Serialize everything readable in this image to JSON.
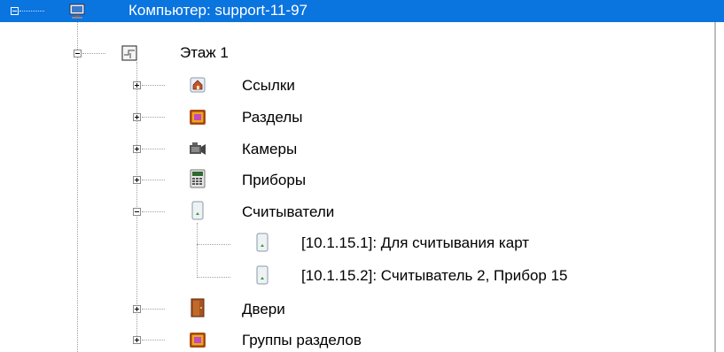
{
  "tree": {
    "root": {
      "label": "Компьютер: support-11-97",
      "icon": "computer-icon",
      "expanded": true,
      "selected": true
    },
    "floor": {
      "label": "Этаж 1",
      "icon": "floor-plan-icon",
      "expanded": true
    },
    "children": [
      {
        "label": "Ссылки",
        "icon": "links-house-icon",
        "expanded": false
      },
      {
        "label": "Разделы",
        "icon": "sections-icon",
        "expanded": false
      },
      {
        "label": "Камеры",
        "icon": "camera-icon",
        "expanded": false
      },
      {
        "label": "Приборы",
        "icon": "device-panel-icon",
        "expanded": false
      },
      {
        "label": "Считыватели",
        "icon": "reader-icon",
        "expanded": true
      },
      {
        "label": "Двери",
        "icon": "door-icon",
        "expanded": false
      },
      {
        "label": "Группы разделов",
        "icon": "section-groups-icon",
        "expanded": false
      }
    ],
    "readers": [
      {
        "label": "[10.1.15.1]: Для считывания карт",
        "icon": "reader-icon"
      },
      {
        "label": "[10.1.15.2]: Считыватель 2, Прибор 15",
        "icon": "reader-icon"
      }
    ]
  },
  "colors": {
    "selection": "#0a74df",
    "selection_text": "#ffffff",
    "connector": "#a0a0a0"
  }
}
